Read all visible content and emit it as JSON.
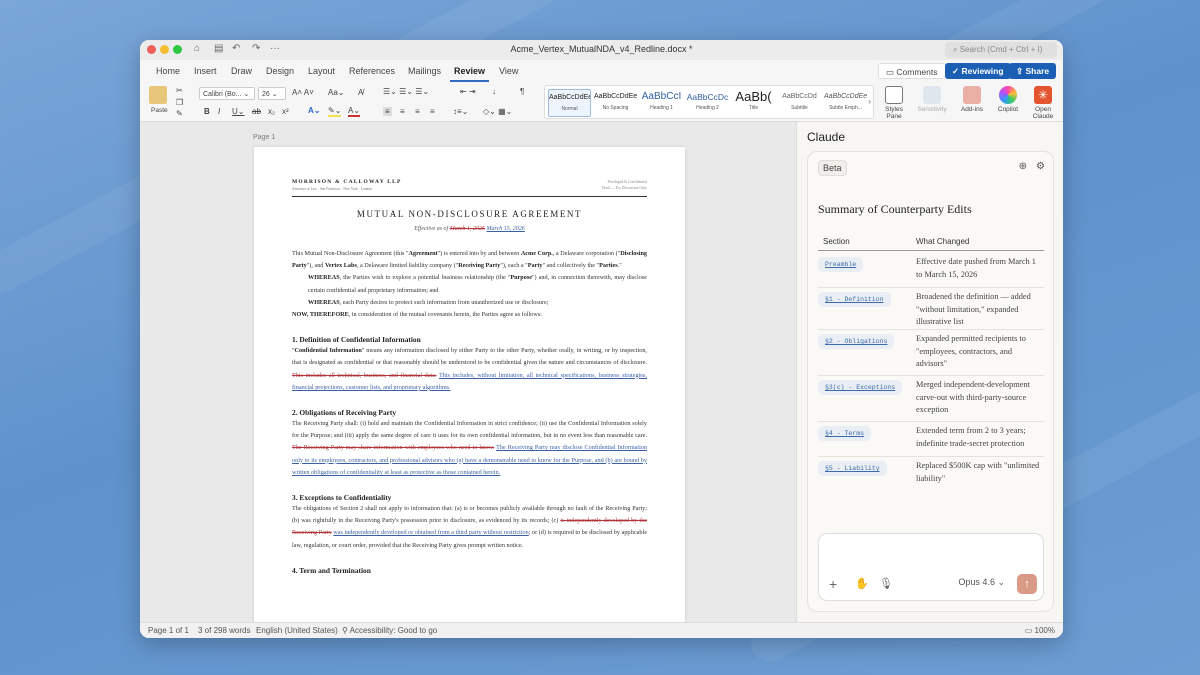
{
  "window": {
    "title": "Acme_Vertex_MutualNDA_v4_Redline.docx *",
    "search_placeholder": "Search (Cmd + Ctrl + I)"
  },
  "tabs": [
    "Home",
    "Insert",
    "Draw",
    "Design",
    "Layout",
    "References",
    "Mailings",
    "Review",
    "View"
  ],
  "active_tab": "Review",
  "actions": {
    "comments": "Comments",
    "reviewing": "Reviewing",
    "share": "Share"
  },
  "ribbon": {
    "paste": "Paste",
    "font": "Calibri (Bo...",
    "size": "26",
    "styles": [
      {
        "preview": "AaBbCcDdEe",
        "name": "Normal"
      },
      {
        "preview": "AaBbCcDdEe",
        "name": "No Spacing"
      },
      {
        "preview": "AaBbCcI",
        "name": "Heading 1"
      },
      {
        "preview": "AaBbCcDc",
        "name": "Heading 2"
      },
      {
        "preview": "AaBb(",
        "name": "Title"
      },
      {
        "preview": "AaBbCcDd",
        "name": "Subtitle"
      },
      {
        "preview": "AaBbCcDdEe",
        "name": "Subtle Emph..."
      }
    ],
    "styles_pane": "Styles Pane",
    "sensitivity": "Sensitivity",
    "addins": "Add-ins",
    "copilot": "Copilot",
    "open_claude": "Open Claude"
  },
  "document": {
    "page_label": "Page 1",
    "firm": "MORRISON & CALLOWAY LLP",
    "firm_sub": "Attorneys at Law · San Francisco · New York · London",
    "header_right1": "Privileged & Confidential",
    "header_right2": "Draft — For Discussion Only",
    "title": "MUTUAL NON-DISCLOSURE AGREEMENT",
    "effective_prefix": "Effective as of ",
    "effective_deleted": "March 1, 2026",
    "effective_inserted": "March 15, 2026",
    "paragraphs": [
      {
        "cls": "p",
        "runs": [
          [
            "n",
            "This Mutual Non-Disclosure Agreement (this \""
          ],
          [
            "b",
            "Agreement"
          ],
          [
            "n",
            "\") is entered into by and between "
          ],
          [
            "b",
            "Acme Corp."
          ],
          [
            "n",
            ", a Delaware corporation (\""
          ],
          [
            "b",
            "Disclosing Party"
          ],
          [
            "n",
            "\"), and "
          ],
          [
            "b",
            "Vertex Labs"
          ],
          [
            "n",
            ", a Delaware limited liability company (\""
          ],
          [
            "b",
            "Receiving Party"
          ],
          [
            "n",
            "\"), each a \""
          ],
          [
            "b",
            "Party"
          ],
          [
            "n",
            "\" and collectively the \""
          ],
          [
            "b",
            "Parties"
          ],
          [
            "n",
            ".\""
          ]
        ]
      },
      {
        "cls": "p ind",
        "runs": [
          [
            "b",
            "WHEREAS"
          ],
          [
            "n",
            ", the Parties wish to explore a potential business relationship (the \""
          ],
          [
            "b",
            "Purpose"
          ],
          [
            "n",
            "\") and, in connection therewith, may disclose certain confidential and proprietary information; and"
          ]
        ]
      },
      {
        "cls": "p ind",
        "runs": [
          [
            "b",
            "WHEREAS"
          ],
          [
            "n",
            ", each Party desires to protect such information from unauthorized use or disclosure;"
          ]
        ]
      },
      {
        "cls": "p",
        "runs": [
          [
            "b",
            "NOW, THEREFORE"
          ],
          [
            "n",
            ", in consideration of the mutual covenants herein, the Parties agree as follows:"
          ]
        ]
      },
      {
        "cls": "sec",
        "runs": [
          [
            "n",
            "1. Definition of Confidential Information"
          ]
        ]
      },
      {
        "cls": "p",
        "runs": [
          [
            "n",
            "\""
          ],
          [
            "b",
            "Confidential Information"
          ],
          [
            "n",
            "\" means any information disclosed by either Party to the other Party, whether orally, in writing, or by inspection, that is designated as confidential or that reasonably should be understood to be confidential given the nature and circumstances of disclosure. "
          ],
          [
            "del",
            "This includes all technical, business, and financial data."
          ],
          [
            "n",
            " "
          ],
          [
            "ins",
            "This includes, without limitation, all technical specifications, business strategies, financial projections, customer lists, and proprietary algorithms."
          ]
        ]
      },
      {
        "cls": "sec",
        "runs": [
          [
            "n",
            "2. Obligations of Receiving Party"
          ]
        ]
      },
      {
        "cls": "p",
        "runs": [
          [
            "n",
            "The Receiving Party shall: (i) hold and maintain the Confidential Information in strict confidence; (ii) use the Confidential Information solely for the Purpose; and (iii) apply the same degree of care it uses for its own confidential information, but in no event less than reasonable care. "
          ],
          [
            "del",
            "The Receiving Party may share information with employees who need to know."
          ],
          [
            "n",
            " "
          ],
          [
            "ins",
            "The Receiving Party may disclose Confidential Information only to its employees, contractors, and professional advisors who (a) have a demonstrable need to know for the Purpose, and (b) are bound by written obligations of confidentiality at least as protective as those contained herein."
          ]
        ]
      },
      {
        "cls": "sec",
        "runs": [
          [
            "n",
            "3. Exceptions to Confidentiality"
          ]
        ]
      },
      {
        "cls": "p",
        "runs": [
          [
            "n",
            "The obligations of Section 2 shall not apply to information that: (a) is or becomes publicly available through no fault of the Receiving Party; (b) was rightfully in the Receiving Party's possession prior to disclosure, as evidenced by its records; (c) "
          ],
          [
            "del",
            "is independently developed by the Receiving Party"
          ],
          [
            "n",
            " "
          ],
          [
            "ins",
            "was independently developed or obtained from a third party without restriction"
          ],
          [
            "n",
            "; or (d) is required to be disclosed by applicable law, regulation, or court order, provided that the Receiving Party gives prompt written notice."
          ]
        ]
      },
      {
        "cls": "sec",
        "runs": [
          [
            "n",
            "4. Term and Termination"
          ]
        ]
      }
    ]
  },
  "claude": {
    "title": "Claude",
    "badge": "Beta",
    "summary_title": "Summary of Counterparty Edits",
    "col_section": "Section",
    "col_changed": "What Changed",
    "rows": [
      {
        "section": "Preamble",
        "change": "Effective date pushed from March 1 to March 15, 2026"
      },
      {
        "section": "§1 - Definition",
        "change": "Broadened the definition — added \"without limitation,\" expanded illustrative list"
      },
      {
        "section": "§2 - Obligations",
        "change": "Expanded permitted recipients to \"employees, contractors, and advisors\""
      },
      {
        "section": "§3(c) - Exceptions",
        "change": "Merged independent-development carve-out with third-party-source exception"
      },
      {
        "section": "§4 - Terms",
        "change": "Extended term from 2 to 3 years; indefinite trade-secret protection"
      },
      {
        "section": "§5 - Liability",
        "change": "Replaced $500K cap with \"unlimited liability\""
      }
    ],
    "model": "Opus 4.6"
  },
  "status": {
    "page": "Page 1 of 1",
    "words": "3 of 298 words",
    "language": "English (United States)",
    "accessibility": "Accessibility: Good to go",
    "zoom": "100%"
  }
}
